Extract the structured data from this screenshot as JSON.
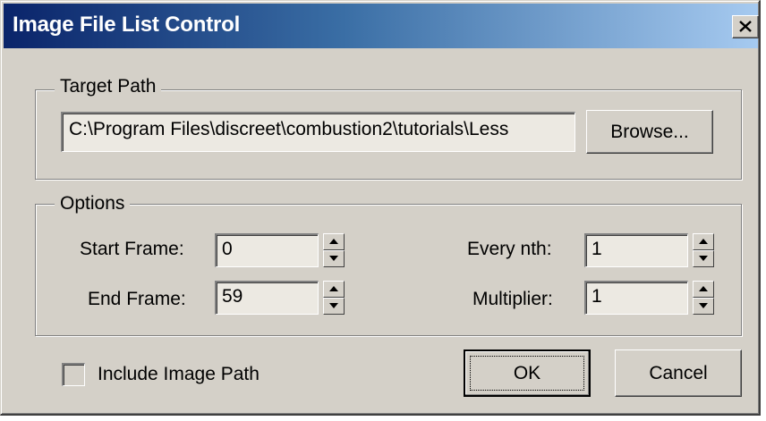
{
  "window": {
    "title": "Image File List Control"
  },
  "target_path": {
    "legend": "Target Path",
    "value": "C:\\Program Files\\discreet\\combustion2\\tutorials\\Less",
    "browse_label": "Browse..."
  },
  "options": {
    "legend": "Options",
    "start_frame": {
      "label": "Start Frame:",
      "value": "0"
    },
    "end_frame": {
      "label": "End Frame:",
      "value": "59"
    },
    "every_nth": {
      "label": "Every nth:",
      "value": "1"
    },
    "multiplier": {
      "label": "Multiplier:",
      "value": "1"
    }
  },
  "include_image_path": {
    "label": "Include Image Path",
    "checked": false
  },
  "buttons": {
    "ok": "OK",
    "cancel": "Cancel"
  }
}
